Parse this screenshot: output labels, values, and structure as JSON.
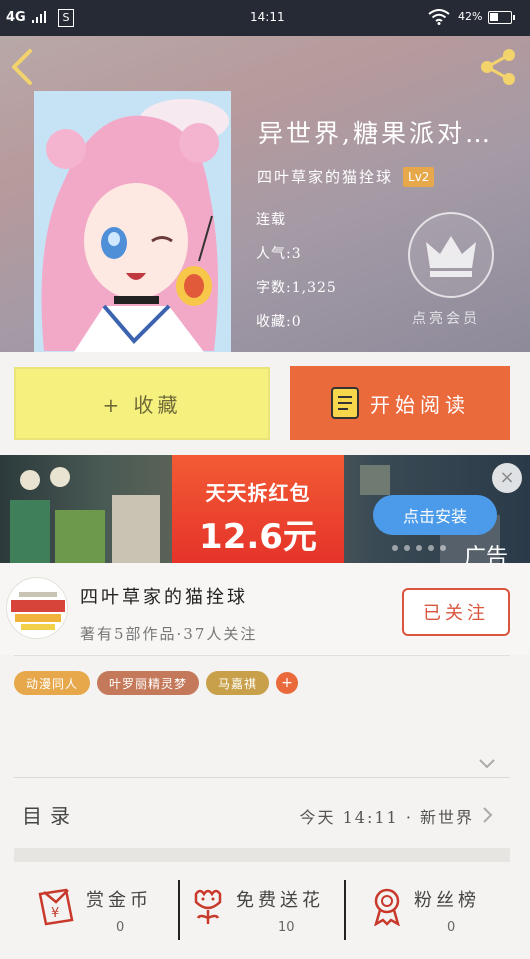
{
  "status_bar": {
    "network": "4G",
    "time": "14:11",
    "battery": "42%",
    "battery_level": 0.42
  },
  "book": {
    "title": "异世界,糖果派对…",
    "author": "四叶草家的猫拴球",
    "level": "Lv2",
    "status": "连载",
    "popularity": "人气:3",
    "word_count": "字数:1,325",
    "favorites": "收藏:0",
    "vip_label": "点亮会员"
  },
  "actions": {
    "collect_label": "+ 收藏",
    "read_label": "开始阅读"
  },
  "ad": {
    "headline": "天天拆红包",
    "amount": "12.6元",
    "install_label": "点击安装",
    "ad_label": "广告",
    "close_symbol": "×"
  },
  "author_card": {
    "name": "四叶草家的猫拴球",
    "summary": "著有5部作品·37人关注",
    "follow_label": "已关注"
  },
  "tags": [
    {
      "label": "动漫同人",
      "color": "#e6a84a"
    },
    {
      "label": "叶罗丽精灵梦",
      "color": "#c47a5a"
    },
    {
      "label": "马嘉祺",
      "color": "#c9a04a"
    }
  ],
  "tag_add": "+",
  "toc": {
    "label": "目录",
    "latest": "今天 14:11 · 新世界"
  },
  "stats": [
    {
      "label": "赏金币",
      "value": "0",
      "icon": "red-envelope-icon"
    },
    {
      "label": "免费送花",
      "value": "10",
      "icon": "flower-icon"
    },
    {
      "label": "粉丝榜",
      "value": "0",
      "icon": "medal-icon"
    }
  ],
  "colors": {
    "accent": "#ea6a3c",
    "collect_button": "#f6f07f",
    "follow_border": "#d9553e",
    "icon_red": "#c8392b"
  }
}
